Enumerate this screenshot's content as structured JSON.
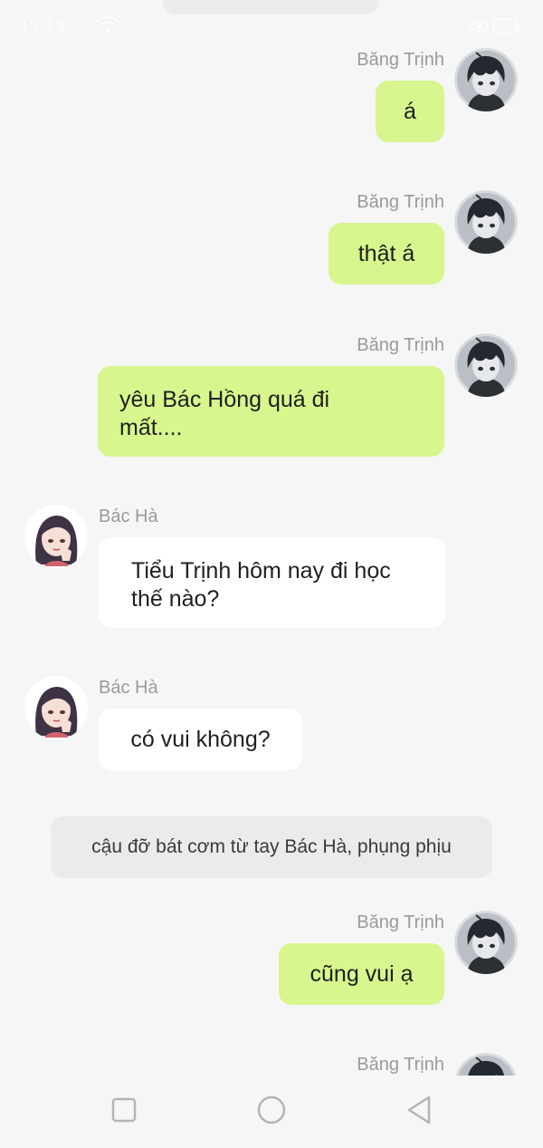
{
  "status_bar": {
    "time": "15:13"
  },
  "messages": [
    {
      "sender": "Băng Trịnh",
      "side": "out",
      "text": "á"
    },
    {
      "sender": "Băng Trịnh",
      "side": "out",
      "text": "thật á"
    },
    {
      "sender": "Băng Trịnh",
      "side": "out",
      "text": "yêu Bác Hồng quá đi mất...."
    },
    {
      "sender": "Bác Hà",
      "side": "in",
      "text": "Tiểu Trịnh hôm nay đi học thế nào?"
    },
    {
      "sender": "Bác Hà",
      "side": "in",
      "text": "có vui không?"
    },
    {
      "sender": "Băng Trịnh",
      "side": "out",
      "text": "cũng vui ạ"
    },
    {
      "sender": "Băng Trịnh",
      "side": "out",
      "text": ""
    }
  ],
  "narration": "cậu đỡ bát cơm từ tay Bác Hà, phụng phịu",
  "icons": {
    "boy_avatar": "boy-avatar-icon",
    "girl_avatar": "girl-avatar-icon",
    "nav": [
      "square-recents-icon",
      "circle-home-icon",
      "triangle-back-icon"
    ]
  },
  "colors": {
    "outgoing_bubble": "#d7f68d",
    "incoming_bubble": "#ffffff",
    "narration_bg": "#ebebeb",
    "sender_name": "#9a9a9a",
    "background": "#f6f6f6"
  }
}
